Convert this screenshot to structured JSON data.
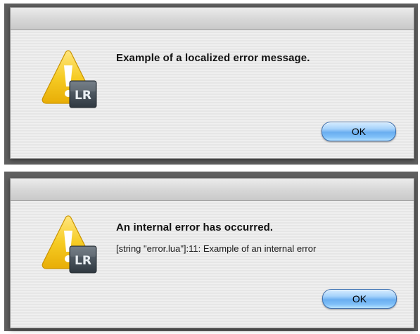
{
  "dialogs": [
    {
      "message": "Example of a localized error message.",
      "detail": "",
      "ok_label": "OK",
      "icon": "warning-lightroom-icon",
      "badge_text": "LR"
    },
    {
      "message": "An internal error has occurred.",
      "detail": "[string \"error.lua\"]:11: Example of an internal error",
      "ok_label": "OK",
      "icon": "warning-lightroom-icon",
      "badge_text": "LR"
    }
  ],
  "colors": {
    "warning_yellow": "#f3c51e",
    "badge_dark": "#3d4750",
    "button_blue": "#7fc0f8"
  }
}
